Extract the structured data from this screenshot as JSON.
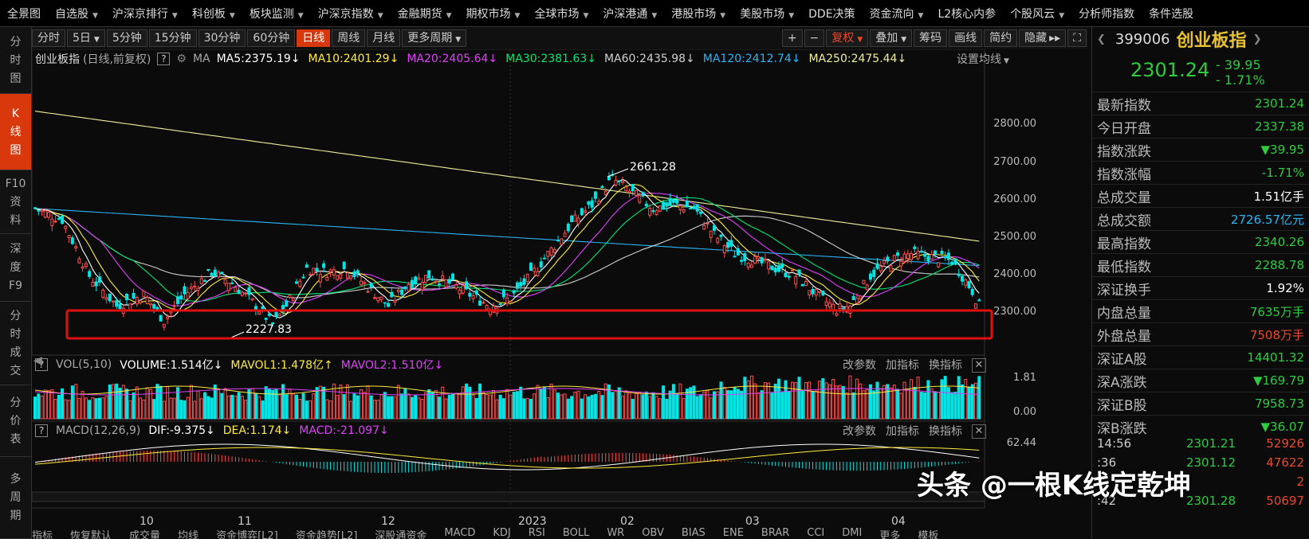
{
  "menu": [
    {
      "label": "全景图",
      "dd": false
    },
    {
      "label": "自选股",
      "dd": true
    },
    {
      "label": "沪深京排行",
      "dd": true
    },
    {
      "label": "科创板",
      "dd": true
    },
    {
      "label": "板块监测",
      "dd": true
    },
    {
      "label": "沪深京指数",
      "dd": true
    },
    {
      "label": "金融期货",
      "dd": true
    },
    {
      "label": "期权市场",
      "dd": true
    },
    {
      "label": "全球市场",
      "dd": true
    },
    {
      "label": "沪深港通",
      "dd": true
    },
    {
      "label": "港股市场",
      "dd": true
    },
    {
      "label": "美股市场",
      "dd": true
    },
    {
      "label": "DDE决策",
      "dd": false
    },
    {
      "label": "资金流向",
      "dd": true
    },
    {
      "label": "L2核心内参",
      "dd": false
    },
    {
      "label": "个股风云",
      "dd": true
    },
    {
      "label": "分析师指数",
      "dd": false
    },
    {
      "label": "条件选股",
      "dd": false
    }
  ],
  "left_tabs": [
    {
      "label": "分时图",
      "chars": [
        "分",
        "时",
        "图"
      ],
      "active": false
    },
    {
      "label": "K线图",
      "chars": [
        "K",
        "线",
        "图"
      ],
      "active": true
    },
    {
      "label": "F10资料",
      "chars": [
        "F10",
        "资",
        "料"
      ],
      "active": false
    },
    {
      "label": "深度F9",
      "chars": [
        "深",
        "度",
        "F9"
      ],
      "active": false
    },
    {
      "label": "分时成交",
      "chars": [
        "分",
        "时",
        "成",
        "交"
      ],
      "active": false
    },
    {
      "label": "分价表",
      "chars": [
        "分",
        "价",
        "表"
      ],
      "active": false
    },
    {
      "label": "多周期",
      "chars": [
        "多",
        "周",
        "期"
      ],
      "active": false
    }
  ],
  "toolbar": {
    "periods": [
      "分时",
      "5日",
      "5分钟",
      "15分钟",
      "30分钟",
      "60分钟",
      "日线",
      "周线",
      "月线",
      "更多周期"
    ],
    "active_period": "日线",
    "right_tools": [
      "复权",
      "叠加",
      "筹码",
      "画线",
      "简约",
      "隐藏"
    ]
  },
  "main_title": "创业板指",
  "main_subtitle": "(日线,前复权)",
  "ma_label": "MA",
  "ma": [
    {
      "text": "MA5:2375.19↓",
      "color": "#ffffff"
    },
    {
      "text": "MA10:2401.29↓",
      "color": "#ffeb3b"
    },
    {
      "text": "MA20:2405.64↓",
      "color": "#e040fb"
    },
    {
      "text": "MA30:2381.63↓",
      "color": "#00e676"
    },
    {
      "text": "MA60:2435.98↓",
      "color": "#cfcfcf"
    },
    {
      "text": "MA120:2412.74↓",
      "color": "#29b6f6"
    },
    {
      "text": "MA250:2475.44↓",
      "color": "#eeee99"
    }
  ],
  "ma_settings": "设置均线",
  "annotations": {
    "high": "2661.28",
    "low": "2227.83"
  },
  "price_axis": [
    "2800.00",
    "2700.00",
    "2600.00",
    "2500.00",
    "2400.00",
    "2300.00"
  ],
  "vol": {
    "label": "VOL(5,10)",
    "items": [
      {
        "text": "VOLUME:1.514亿↓",
        "color": "#ffffff"
      },
      {
        "text": "MAVOL1:1.478亿↑",
        "color": "#ffeb3b"
      },
      {
        "text": "MAVOL2:1.510亿↓",
        "color": "#e040fb"
      }
    ],
    "axis": [
      "1.81",
      "0.00"
    ]
  },
  "macd": {
    "label": "MACD(12,26,9)",
    "items": [
      {
        "text": "DIF:-9.375↓",
        "color": "#ffffff"
      },
      {
        "text": "DEA:1.174↓",
        "color": "#ffeb3b"
      },
      {
        "text": "MACD:-21.097↓",
        "color": "#e040fb"
      }
    ],
    "axis": [
      "62.44"
    ]
  },
  "sub_controls": [
    "改参数",
    "加指标",
    "换指标"
  ],
  "x_axis": [
    "10",
    "11",
    "12",
    "2023",
    "02",
    "03",
    "04"
  ],
  "bottom_tabs": [
    "指标",
    "恢复默认",
    "成交量",
    "均线",
    "资金博弈[L2]",
    "资金趋势[L2]",
    "深股通资金",
    "MACD",
    "KDJ",
    "RSI",
    "BOLL",
    "WR",
    "OBV",
    "BIAS",
    "ENE",
    "BRAR",
    "CCI",
    "DMI",
    "更多",
    "模板"
  ],
  "right_panel": {
    "code": "399006",
    "name": "创业板指",
    "price": "2301.24",
    "change": "- 39.95",
    "change_pct": "- 1.71%",
    "rows": [
      {
        "label": "最新指数",
        "value": "2301.24",
        "color": "#2ecc40"
      },
      {
        "label": "今日开盘",
        "value": "2337.38",
        "color": "#2ecc40"
      },
      {
        "label": "指数涨跌",
        "value": "▼39.95",
        "color": "#2ecc40"
      },
      {
        "label": "指数涨幅",
        "value": "-1.71%",
        "color": "#2ecc40"
      },
      {
        "label": "总成交量",
        "value": "1.51亿手",
        "color": "#ffffff"
      },
      {
        "label": "总成交额",
        "value": "2726.57亿元",
        "color": "#29b6f6"
      },
      {
        "label": "最高指数",
        "value": "2340.26",
        "color": "#2ecc40"
      },
      {
        "label": "最低指数",
        "value": "2288.78",
        "color": "#2ecc40"
      },
      {
        "label": "深证换手",
        "value": "1.92%",
        "color": "#ffffff"
      },
      {
        "label": "内盘总量",
        "value": "7635万手",
        "color": "#2ecc40"
      },
      {
        "label": "外盘总量",
        "value": "7508万手",
        "color": "#e84b2c"
      },
      {
        "label": "深证A股",
        "value": "14401.32",
        "color": "#2ecc40"
      },
      {
        "label": "深A涨跌",
        "value": "▼169.79",
        "color": "#2ecc40"
      },
      {
        "label": "深证B股",
        "value": "7958.73",
        "color": "#2ecc40"
      },
      {
        "label": "深B涨跌",
        "value": "▼36.07",
        "color": "#2ecc40"
      }
    ],
    "ticks": [
      {
        "time": "14:56",
        "price": "2301.21",
        "vol": "52926"
      },
      {
        "time": ":36",
        "price": "2301.12",
        "vol": "47622"
      },
      {
        "time": "",
        "price": "",
        "vol": "2"
      },
      {
        "time": ":42",
        "price": "2301.28",
        "vol": "50697"
      }
    ]
  },
  "watermark": "头条 @一根K线定乾坤",
  "colors": {
    "up": "#ff4d4d",
    "down": "#00e5e5",
    "highlight_box": "#e01010"
  }
}
